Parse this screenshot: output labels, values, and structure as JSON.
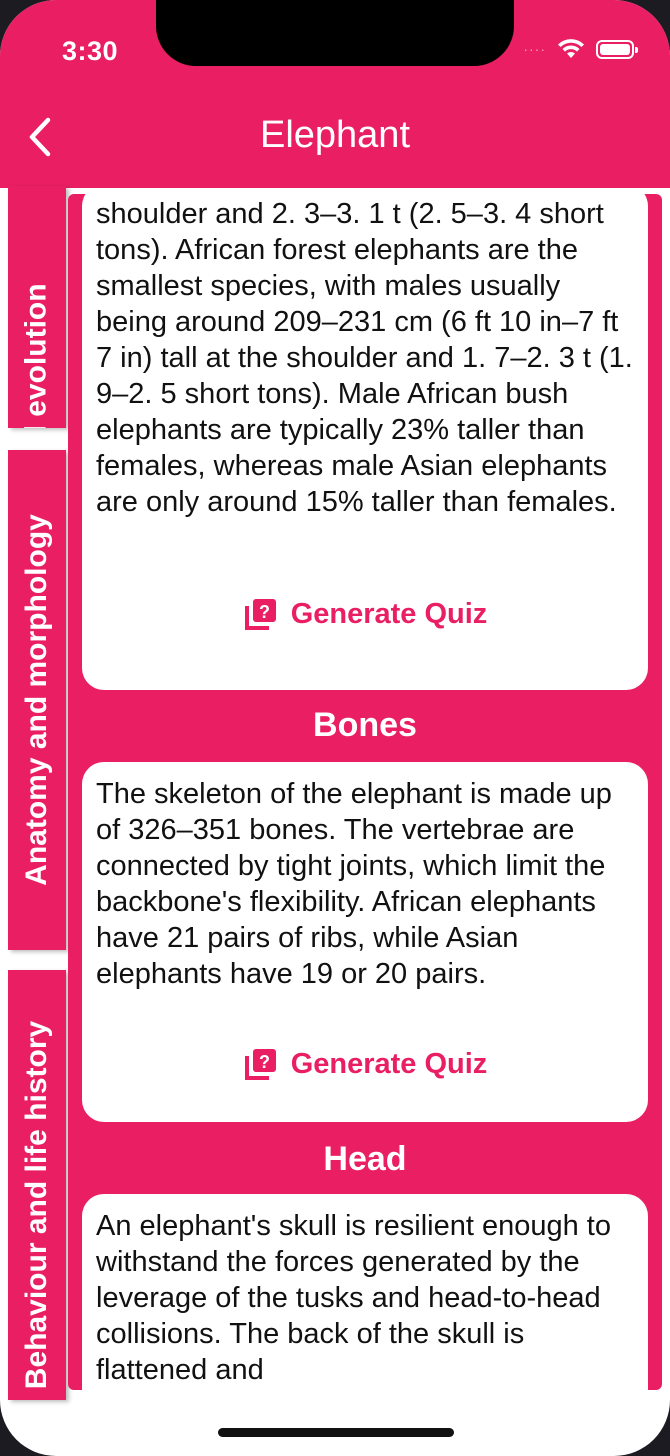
{
  "status_bar": {
    "time": "3:30",
    "dots": "····"
  },
  "app_bar": {
    "title": "Elephant",
    "back_icon": "chevron-left-icon"
  },
  "side_tabs": [
    {
      "label": "Taxonomy and evolution"
    },
    {
      "label": "Anatomy and morphology"
    },
    {
      "label": "Behaviour and life history"
    }
  ],
  "sections": [
    {
      "title": "",
      "text": "shoulder and 2. 3–3. 1 t (2. 5–3. 4 short tons). African forest elephants are the smallest species, with males usually being around 209–231 cm (6 ft 10 in–7 ft 7 in) tall at the shoulder and 1. 7–2. 3 t (1. 9–2. 5 short tons). Male African bush elephants are typically 23% taller than females, whereas male Asian elephants are only around 15% taller than females.",
      "quiz_label": "Generate Quiz"
    },
    {
      "title": "Bones",
      "text": "The skeleton of the elephant is made up of 326–351 bones. The vertebrae are connected by tight joints, which limit the backbone's flexibility. African elephants have 21 pairs of ribs, while Asian elephants have 19 or 20 pairs.",
      "quiz_label": "Generate Quiz"
    },
    {
      "title": "Head",
      "text": "An elephant's skull is resilient enough to withstand the forces generated by the leverage of the tusks and head-to-head collisions. The back of the skull is flattened and"
    }
  ],
  "colors": {
    "accent": "#e91e63",
    "card": "#ffffff",
    "text": "#111111"
  }
}
